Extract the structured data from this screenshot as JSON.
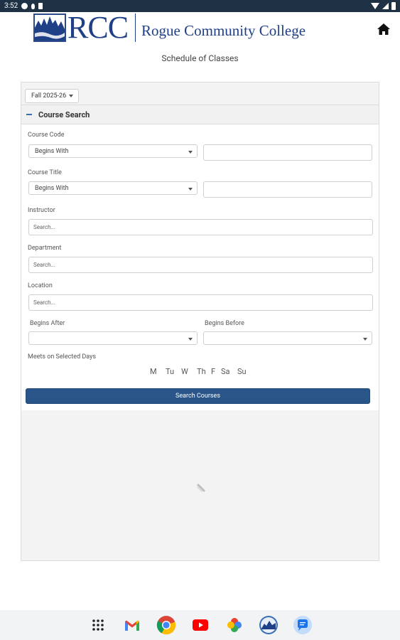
{
  "status_bar": {
    "time": "3:52"
  },
  "header": {
    "logo_letters": "RCC",
    "college_name": "Rogue Community College"
  },
  "page_title": "Schedule of Classes",
  "term": {
    "selected": "Fall 2025-26"
  },
  "course_search": {
    "title": "Course Search",
    "course_code": {
      "label": "Course Code",
      "match": "Begins With",
      "value": ""
    },
    "course_title": {
      "label": "Course Title",
      "match": "Begins With",
      "value": ""
    },
    "instructor": {
      "label": "Instructor",
      "placeholder": "Search..."
    },
    "department": {
      "label": "Department",
      "placeholder": "Search..."
    },
    "location": {
      "label": "Location",
      "placeholder": "Search..."
    },
    "begins_after": {
      "label": "Begins After",
      "value": ""
    },
    "begins_before": {
      "label": "Begins Before",
      "value": ""
    },
    "meets_label": "Meets on Selected Days",
    "days": [
      "M",
      "Tu",
      "W",
      "Th",
      "F",
      "Sa",
      "Su"
    ],
    "search_button": "Search Courses"
  },
  "dock": {
    "apps": [
      "app-drawer-icon",
      "gmail-icon",
      "chrome-icon",
      "youtube-icon",
      "photos-icon",
      "rcc-app-icon",
      "messages-icon"
    ]
  },
  "colors": {
    "status_bar": "#1f3144",
    "brand_blue": "#1f3f86",
    "button_blue": "#2a5588",
    "panel_bg": "#f3f3f3"
  }
}
